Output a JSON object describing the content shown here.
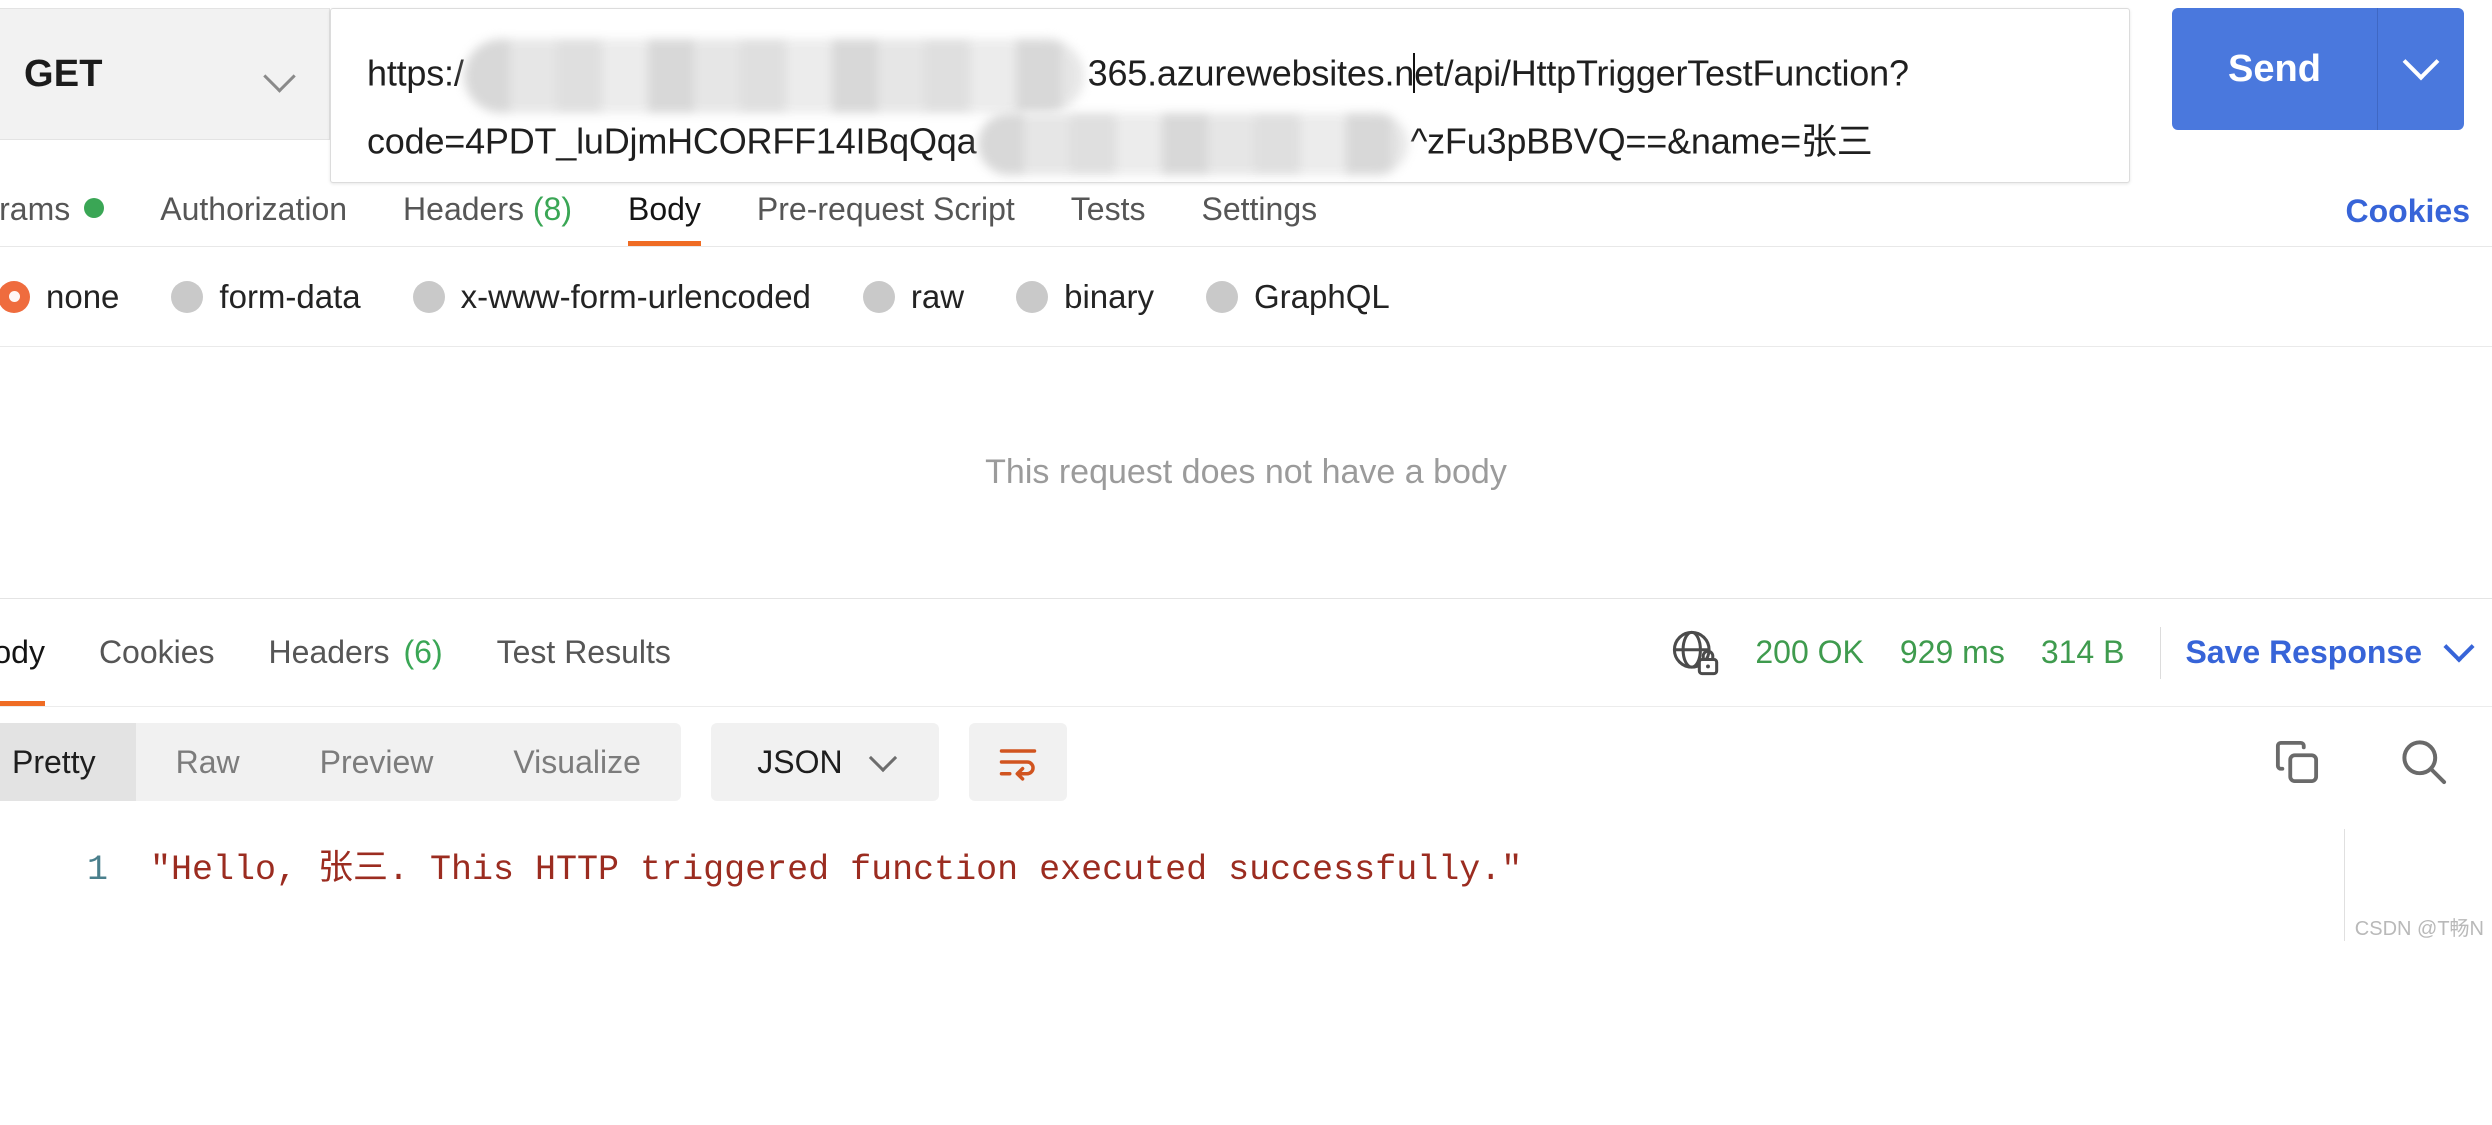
{
  "request": {
    "method": "GET",
    "url_line_1_prefix": "https:/",
    "url_line_1_suffix": "365.azurewebsites.n",
    "url_line_1_tail": "et/api/HttpTriggerTestFunction?",
    "url_line_2_prefix": "code=4PDT_luDjmHCORFF14IBqQqa",
    "url_line_2_middle": "^zFu3pBBVQ==&name=张三",
    "send_label": "Send",
    "send_caret_icon": "chevron-down-icon",
    "method_caret_icon": "chevron-down-icon"
  },
  "request_tabs": {
    "items": [
      {
        "label": "Params",
        "badge": "",
        "dot": true,
        "active": false
      },
      {
        "label": "Authorization",
        "badge": "",
        "dot": false,
        "active": false
      },
      {
        "label": "Headers",
        "badge": "(8)",
        "dot": false,
        "active": false
      },
      {
        "label": "Body",
        "badge": "",
        "dot": false,
        "active": true
      },
      {
        "label": "Pre-request Script",
        "badge": "",
        "dot": false,
        "active": false
      },
      {
        "label": "Tests",
        "badge": "",
        "dot": false,
        "active": false
      },
      {
        "label": "Settings",
        "badge": "",
        "dot": false,
        "active": false
      }
    ],
    "cookies_label": "Cookies"
  },
  "body_types": {
    "options": [
      {
        "label": "none",
        "checked": true
      },
      {
        "label": "form-data",
        "checked": false
      },
      {
        "label": "x-www-form-urlencoded",
        "checked": false
      },
      {
        "label": "raw",
        "checked": false
      },
      {
        "label": "binary",
        "checked": false
      },
      {
        "label": "GraphQL",
        "checked": false
      }
    ],
    "empty_message": "This request does not have a body"
  },
  "response_tabs": {
    "items": [
      {
        "label": "Body",
        "badge": "",
        "active": true
      },
      {
        "label": "Cookies",
        "badge": "",
        "active": false
      },
      {
        "label": "Headers",
        "badge": "(6)",
        "active": false
      },
      {
        "label": "Test Results",
        "badge": "",
        "active": false
      }
    ],
    "status": "200 OK",
    "time": "929 ms",
    "size": "314 B",
    "security_icon": "globe-lock-icon",
    "save_response_label": "Save Response",
    "save_response_caret_icon": "chevron-down-icon"
  },
  "pretty_bar": {
    "views": [
      {
        "label": "Pretty",
        "active": true
      },
      {
        "label": "Raw",
        "active": false
      },
      {
        "label": "Preview",
        "active": false
      },
      {
        "label": "Visualize",
        "active": false
      }
    ],
    "format": "JSON",
    "format_caret_icon": "chevron-down-icon",
    "wrap_icon": "word-wrap-icon",
    "copy_icon": "copy-icon",
    "search_icon": "search-icon"
  },
  "response_body": {
    "line_number": "1",
    "content": "\"Hello, 张三. This HTTP triggered function executed successfully.\""
  },
  "watermark": "CSDN @T畅N",
  "colors": {
    "accent_orange": "#ef6c24",
    "link_blue": "#3764d8",
    "send_blue": "#4a78dd",
    "status_green": "#3f9b4e",
    "code_red": "#9b2c20",
    "line_number_teal": "#4a7f8c"
  }
}
